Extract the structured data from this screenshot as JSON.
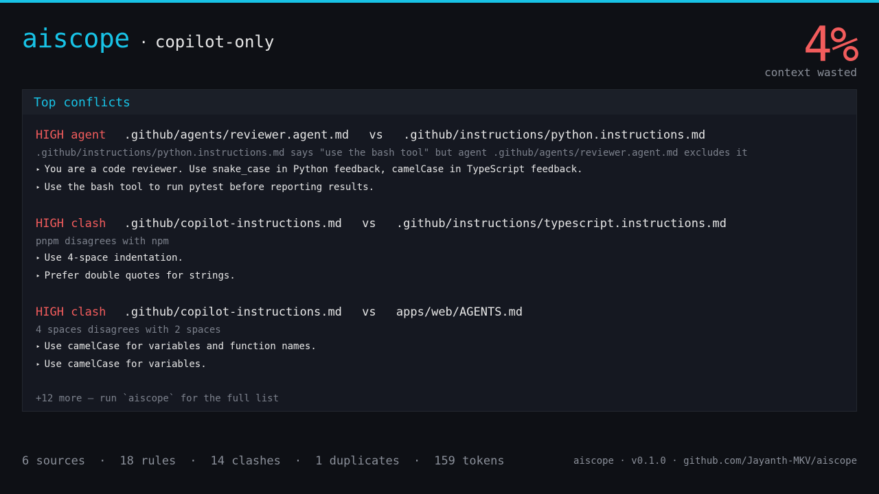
{
  "brand": {
    "name": "aiscope",
    "separator": "·",
    "mode": "copilot-only"
  },
  "metric": {
    "value": "4%",
    "label": "context wasted"
  },
  "panel": {
    "title": "Top conflicts",
    "conflicts": [
      {
        "severity": "HIGH",
        "kind": "agent",
        "source_a": ".github/agents/reviewer.agent.md",
        "vs": "vs",
        "source_b": ".github/instructions/python.instructions.md",
        "reason": ".github/instructions/python.instructions.md says \"use the bash tool\" but agent .github/agents/reviewer.agent.md excludes it",
        "rules": [
          "You are a code reviewer. Use snake_case in Python feedback, camelCase in TypeScript feedback.",
          "Use the bash tool to run pytest before reporting results."
        ]
      },
      {
        "severity": "HIGH",
        "kind": "clash",
        "source_a": ".github/copilot-instructions.md",
        "vs": "vs",
        "source_b": ".github/instructions/typescript.instructions.md",
        "reason": "pnpm disagrees with npm",
        "rules": [
          "Use 4-space indentation.",
          "Prefer double quotes for strings."
        ]
      },
      {
        "severity": "HIGH",
        "kind": "clash",
        "source_a": ".github/copilot-instructions.md",
        "vs": "vs",
        "source_b": "apps/web/AGENTS.md",
        "reason": "4 spaces disagrees with 2 spaces",
        "rules": [
          "Use camelCase for variables and function names.",
          "Use camelCase for variables."
        ]
      }
    ],
    "bullet": "‣",
    "more": "+12 more — run `aiscope` for the full list"
  },
  "footer": {
    "stats": [
      "6 sources",
      "18 rules",
      "14 clashes",
      "1 duplicates",
      "159 tokens"
    ],
    "separator": "·",
    "meta": "aiscope · v0.1.0 · github.com/Jayanth-MKV/aiscope"
  },
  "colors": {
    "accent": "#18c3e6",
    "danger": "#f25c5c",
    "background": "#0e1015",
    "panel": "#151821"
  }
}
